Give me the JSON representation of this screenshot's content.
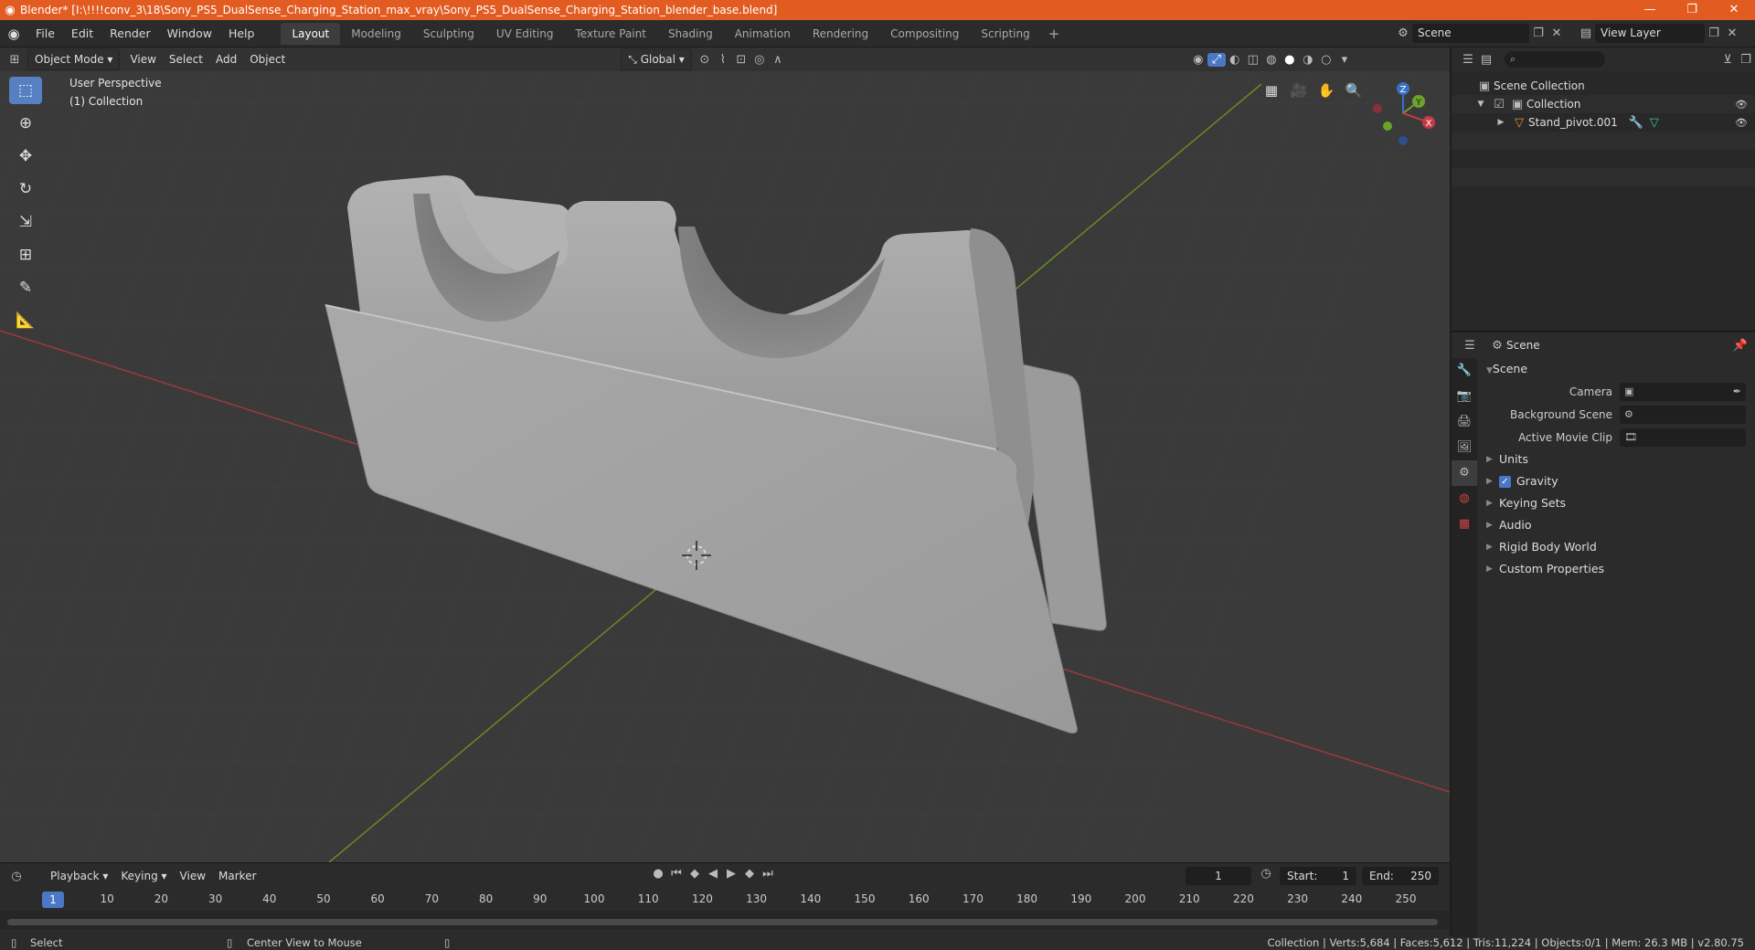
{
  "titlebar": {
    "title": "Blender* [I:\\!!!!conv_3\\18\\Sony_PS5_DualSense_Charging_Station_max_vray\\Sony_PS5_DualSense_Charging_Station_blender_base.blend]"
  },
  "menu": [
    "File",
    "Edit",
    "Render",
    "Window",
    "Help"
  ],
  "workspaces": [
    "Layout",
    "Modeling",
    "Sculpting",
    "UV Editing",
    "Texture Paint",
    "Shading",
    "Animation",
    "Rendering",
    "Compositing",
    "Scripting"
  ],
  "active_workspace": "Layout",
  "scene_name": "Scene",
  "view_layer": "View Layer",
  "viewport": {
    "mode": "Object Mode",
    "menus": [
      "View",
      "Select",
      "Add",
      "Object"
    ],
    "transform_orientation": "Global",
    "perspective_label": "User Perspective",
    "collection_label": "(1) Collection",
    "gizmo": {
      "x": "X",
      "y": "Y",
      "z": "Z"
    }
  },
  "timeline": {
    "menus": [
      "Playback",
      "Keying",
      "View",
      "Marker"
    ],
    "current_frame": "1",
    "start_label": "Start:",
    "start": "1",
    "end_label": "End:",
    "end": "250",
    "ticks": [
      "10",
      "20",
      "30",
      "40",
      "50",
      "60",
      "70",
      "80",
      "90",
      "100",
      "110",
      "120",
      "130",
      "140",
      "150",
      "160",
      "170",
      "180",
      "190",
      "200",
      "210",
      "220",
      "230",
      "240",
      "250"
    ],
    "current_frame_marker": "1"
  },
  "status": {
    "left": "Select",
    "middle": "Center View to Mouse",
    "right": "Collection | Verts:5,684 | Faces:5,612 | Tris:11,224 | Objects:0/1 | Mem: 26.3 MB | v2.80.75"
  },
  "outliner": {
    "root": "Scene Collection",
    "collection": "Collection",
    "object": "Stand_pivot.001"
  },
  "properties": {
    "header": "Scene",
    "panel": "Scene",
    "rows": [
      {
        "label": "Camera"
      },
      {
        "label": "Background Scene"
      },
      {
        "label": "Active Movie Clip"
      }
    ],
    "subpanels": [
      "Units",
      "Gravity",
      "Keying Sets",
      "Audio",
      "Rigid Body World",
      "Custom Properties"
    ]
  }
}
